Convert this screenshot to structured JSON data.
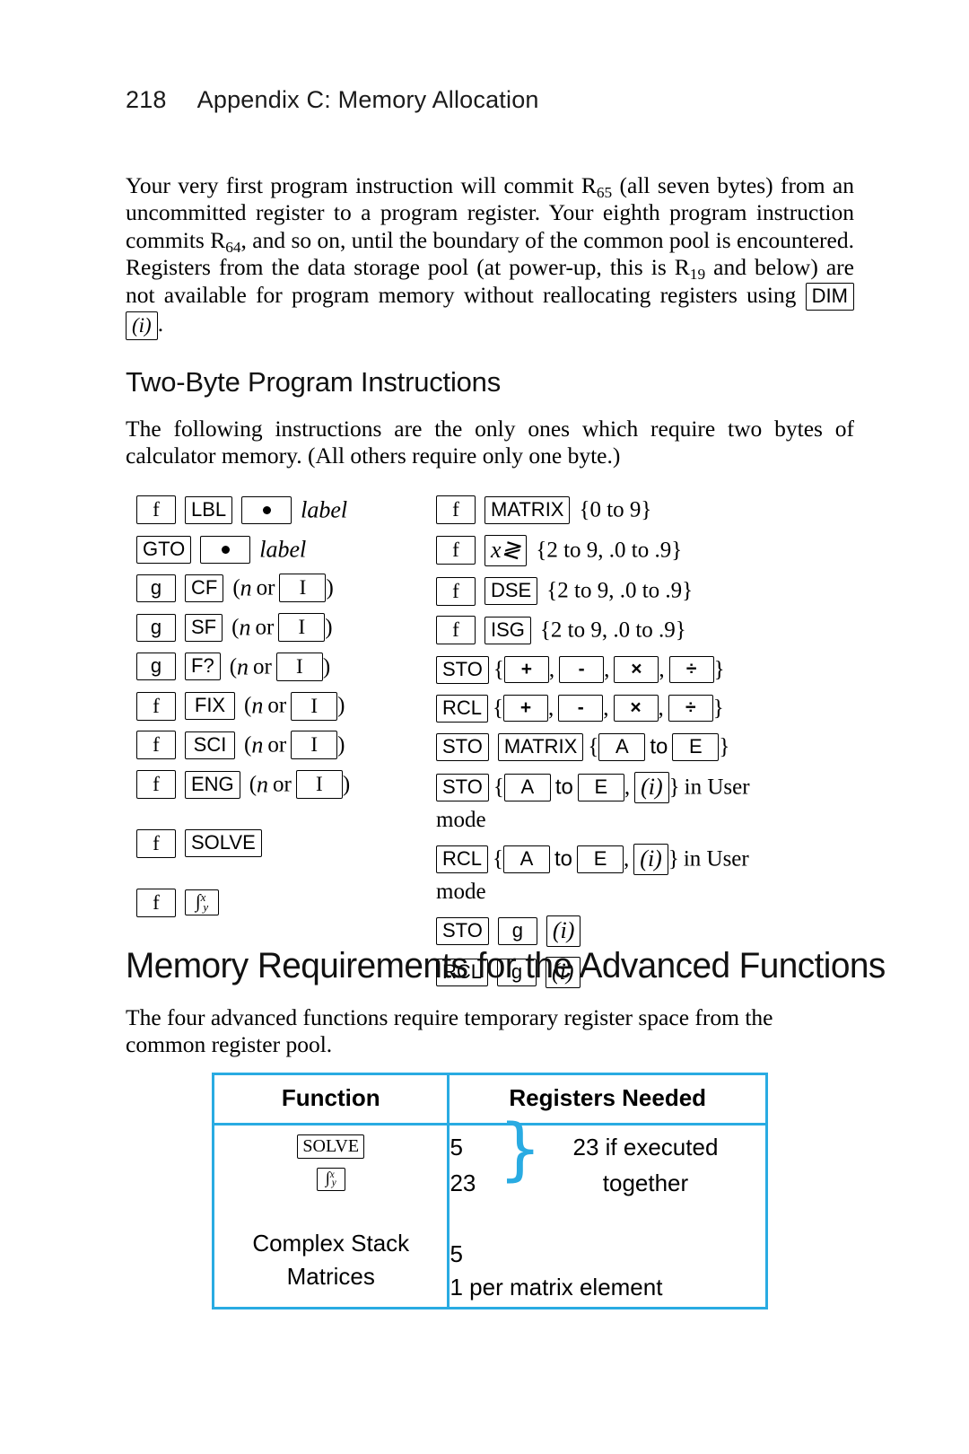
{
  "running_head": {
    "page_number": "218",
    "title": "Appendix C: Memory Allocation"
  },
  "intro_paragraph": {
    "seg1": "Your very first program instruction will commit R",
    "sub1": "65",
    "seg2": " (all seven bytes) from an uncommitted register to a program register. Your eighth program instruction commits R",
    "sub2": "64",
    "seg3": ", and so on, until the boundary of the common pool is encountered. Registers from the data storage pool (at power-up, this is R",
    "sub3": "19",
    "seg4": " and below) are not available for program memory without reallocating registers using ",
    "key_dim": "DIM",
    "key_i": "(i)",
    "seg5": "."
  },
  "section_heading": "Two-Byte Program Instructions",
  "section_paragraph": "The following instructions are the only ones which require two bytes of calculator memory. (All others require only one byte.)",
  "keys": {
    "f": "f",
    "g": "g",
    "lbl": "LBL",
    "gto": "GTO",
    "cf": "CF",
    "sf": "SF",
    "fq": "F?",
    "fix": "FIX",
    "sci": "SCI",
    "eng": "ENG",
    "solve": "SOLVE",
    "matrix": "MATRIX",
    "xexch": "x≷",
    "dse": "DSE",
    "isg": "ISG",
    "sto": "STO",
    "rcl": "RCL",
    "i_index": "I",
    "i_paren": "(i)",
    "a": "A",
    "e": "E",
    "nine": "9",
    "plus": "+",
    "minus": "-",
    "times": "×",
    "divide": "÷",
    "integral_base": "∫",
    "integral_sup": "x",
    "integral_sub": "y"
  },
  "labels": {
    "label_italic": "label",
    "n_italic": "n",
    "or": "or",
    "to": "to",
    "open_paren": "(",
    "close_paren": ")",
    "comma": ",",
    "open_brace": "{",
    "close_brace": "}",
    "range_0_9": "{0 to 9}",
    "range_2_9": "{2 to 9, .0 to .9}",
    "in_user": "in User",
    "mode": "mode"
  },
  "main_heading": "Memory Requirements for the Advanced Functions",
  "main_paragraph": "The four advanced functions require temporary register space from the common register pool.",
  "table": {
    "headers": [
      "Function",
      "Registers Needed"
    ],
    "rows": [
      {
        "function_keys": [
          "SOLVE",
          "integral"
        ],
        "registers_stacked": [
          "5",
          "23"
        ],
        "brace_note_line1": "23 if executed",
        "brace_note_line2": "together"
      },
      {
        "function_label": "Complex Stack",
        "registers": "5"
      },
      {
        "function_label": "Matrices",
        "registers": "1 per matrix element"
      }
    ]
  },
  "colors": {
    "table_border": "#29ABE2",
    "brace": "#29ABE2",
    "text": "#000000"
  }
}
